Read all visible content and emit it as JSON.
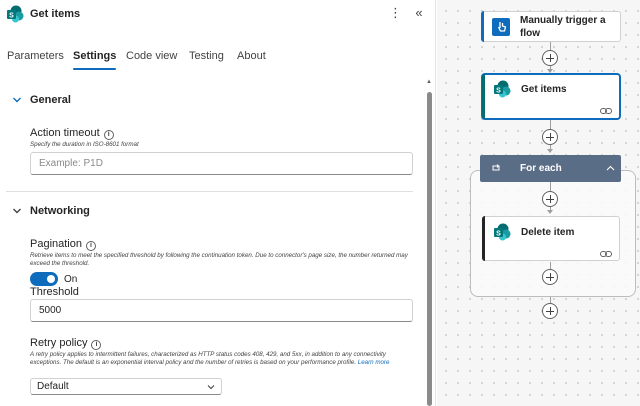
{
  "panel": {
    "title": "Get items",
    "more_icon": "more-vertical-icon",
    "collapse_icon": "double-chevron-left-icon",
    "tabs": [
      {
        "label": "Parameters",
        "active": false
      },
      {
        "label": "Settings",
        "active": true
      },
      {
        "label": "Code view",
        "active": false
      },
      {
        "label": "Testing",
        "active": false
      },
      {
        "label": "About",
        "active": false
      }
    ],
    "general": {
      "title": "General",
      "action_timeout": {
        "label": "Action timeout",
        "hint": "Specify the duration in ISO-8601 format",
        "placeholder": "Example: P1D",
        "value": ""
      }
    },
    "networking": {
      "title": "Networking",
      "pagination": {
        "label": "Pagination",
        "hint": "Retrieve items to meet the specified threshold by following the continuation token. Due to connector's page size, the number returned may exceed the threshold.",
        "toggle_state": "On",
        "threshold_label": "Threshold",
        "threshold_value": "5000"
      },
      "retry_policy": {
        "label": "Retry policy",
        "hint": "A retry policy applies to intermittent failures, characterized as HTTP status codes 408, 429, and 5xx, in addition to any connectivity exceptions. The default is an exponential interval policy and the number of retries is based on your performance profile.",
        "learn_more": "Learn more",
        "selected": "Default"
      }
    }
  },
  "flow": {
    "trigger": {
      "title": "Manually trigger a flow",
      "icon": "manual-trigger-icon",
      "accent": "#0f6cbd"
    },
    "get_items": {
      "title": "Get items",
      "icon": "sharepoint-icon",
      "accent": "#036c70"
    },
    "for_each": {
      "title": "For each",
      "icon": "loop-icon",
      "header_color": "#5a6d86"
    },
    "delete_item": {
      "title": "Delete item",
      "icon": "sharepoint-icon",
      "accent": "#036c70"
    }
  },
  "colors": {
    "accent": "#0f6cbd",
    "sharepoint_teal": "#038387"
  }
}
